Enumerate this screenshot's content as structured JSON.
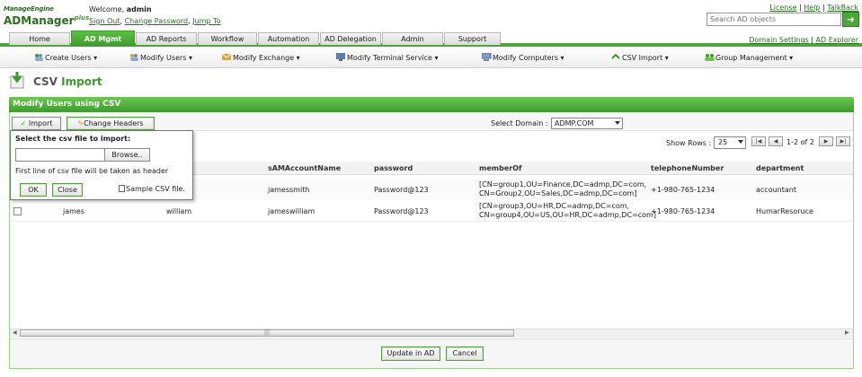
{
  "app": {
    "logo_brand": "ManageEngine",
    "logo_product": "ADManager",
    "logo_edition": "plus"
  },
  "header": {
    "welcome_label": "Welcome,",
    "username": "admin",
    "sign_out": "Sign Out",
    "change_password": "Change Password",
    "jump_to": "Jump To",
    "license": "License",
    "help": "Help",
    "talkback": "TalkBack",
    "search_placeholder": "Search AD objects"
  },
  "tabs": [
    {
      "label": "Home",
      "active": false
    },
    {
      "label": "AD Mgmt",
      "active": true
    },
    {
      "label": "AD Reports",
      "active": false
    },
    {
      "label": "Workflow",
      "active": false
    },
    {
      "label": "Automation",
      "active": false
    },
    {
      "label": "AD Delegation",
      "active": false
    },
    {
      "label": "Admin",
      "active": false
    },
    {
      "label": "Support",
      "active": false
    }
  ],
  "right_links": {
    "domain_settings": "Domain Settings",
    "ad_explorer": "AD Explorer"
  },
  "submenu": [
    {
      "label": "Create Users ▾",
      "icon": "users-icon"
    },
    {
      "label": "Modify Users ▾",
      "icon": "users-icon"
    },
    {
      "label": "Modify Exchange ▾",
      "icon": "exchange-icon"
    },
    {
      "label": "Modify Terminal Service ▾",
      "icon": "terminal-icon"
    },
    {
      "label": "Modify Computers ▾",
      "icon": "computer-icon"
    },
    {
      "label": "CSV Import ▾",
      "icon": "csv-icon"
    },
    {
      "label": "Group Management ▾",
      "icon": "group-icon"
    }
  ],
  "page": {
    "title_part1": "CSV",
    "title_part2": "Import",
    "panel_title": "Modify Users using CSV"
  },
  "actions": {
    "import_label": "Import",
    "change_headers_label": "Change Headers",
    "select_domain_label": "Select Domain :",
    "domain_value": "ADMP.COM"
  },
  "pager": {
    "show_rows_label": "Show Rows :",
    "rows_value": "25",
    "page_info": "1-2 of 2"
  },
  "popup": {
    "label": "Select the csv file to import:",
    "browse": "Browse..",
    "note": "First line of csv file will be taken as header",
    "ok": "OK",
    "close": "Close",
    "sample": "Sample CSV file."
  },
  "table": {
    "headers": [
      "sAMAccountName",
      "password",
      "memberOf",
      "telephoneNumber",
      "department"
    ],
    "rows": [
      {
        "first": "",
        "last": "",
        "sam": "jamessmith",
        "password": "Password@123",
        "memberOf_1": "[CN=group1,OU=Finance,DC=admp,DC=com,",
        "memberOf_2": "CN=Group2,OU=Sales,DC=admp,DC=com]",
        "phone": "+1-980-765-1234",
        "department": "accountant"
      },
      {
        "first": "james",
        "last": "william",
        "sam": "jameswilliam",
        "password": "Password@123",
        "memberOf_1": "[CN=group3,OU=HR,DC=admp,DC=com,",
        "memberOf_2": "CN=group4,OU=US,OU=HR,DC=admp,DC=com]",
        "phone": "+1-980-765-1234",
        "department": "HumarResoruce"
      }
    ]
  },
  "footer": {
    "update_label": "Update in AD",
    "cancel_label": "Cancel"
  },
  "colors": {
    "brand_green": "#3d9a2c",
    "link_green": "#2a6e22"
  }
}
